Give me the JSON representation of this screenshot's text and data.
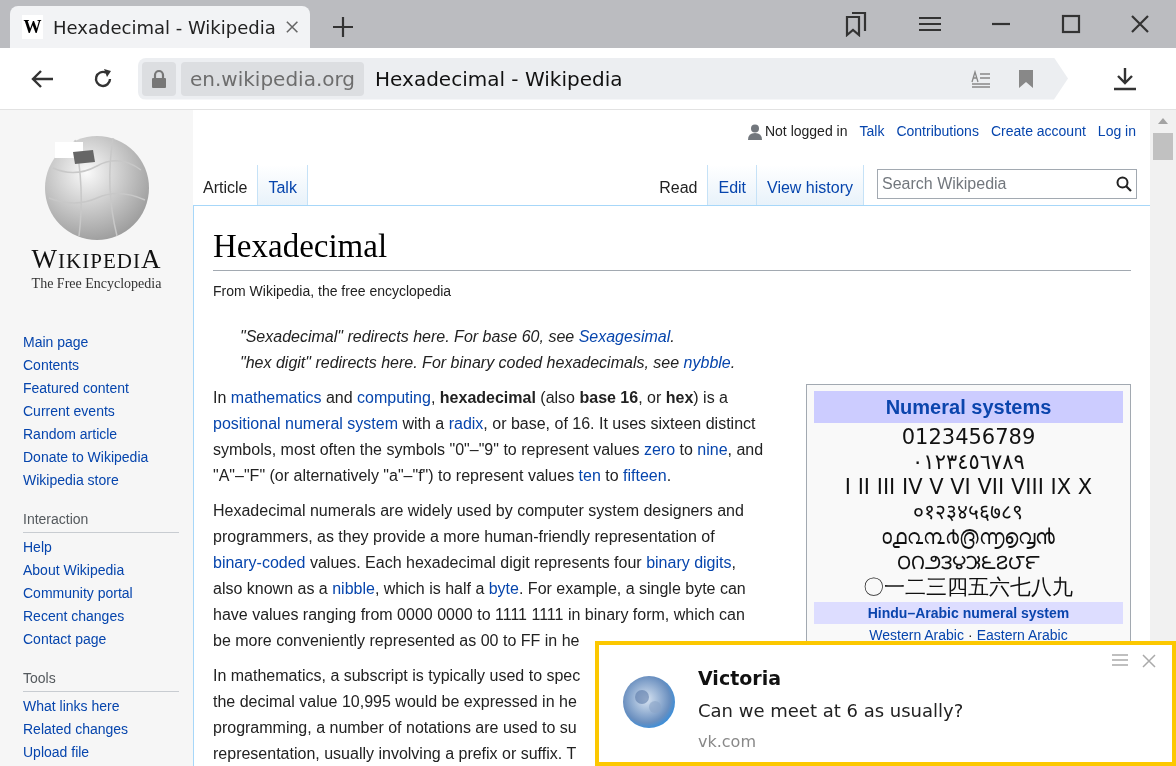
{
  "browser": {
    "tab": {
      "favicon": "W",
      "title": "Hexadecimal - Wikipedia"
    },
    "address": {
      "domain": "en.wikipedia.org",
      "page_title": "Hexadecimal - Wikipedia"
    }
  },
  "sidebar": {
    "logo": {
      "wordmark": "WIKIPEDIA",
      "tagline": "The Free Encyclopedia"
    },
    "navigation": [
      "Main page",
      "Contents",
      "Featured content",
      "Current events",
      "Random article",
      "Donate to Wikipedia",
      "Wikipedia store"
    ],
    "sections": [
      {
        "heading": "Interaction",
        "items": [
          "Help",
          "About Wikipedia",
          "Community portal",
          "Recent changes",
          "Contact page"
        ]
      },
      {
        "heading": "Tools",
        "items": [
          "What links here",
          "Related changes",
          "Upload file"
        ]
      }
    ]
  },
  "personal_tools": {
    "status": "Not logged in",
    "links": [
      "Talk",
      "Contributions",
      "Create account",
      "Log in"
    ]
  },
  "page_tabs": {
    "left": [
      {
        "label": "Article",
        "selected": true
      },
      {
        "label": "Talk",
        "selected": false
      }
    ],
    "right": [
      {
        "label": "Read",
        "selected": true
      },
      {
        "label": "Edit",
        "selected": false
      },
      {
        "label": "View history",
        "selected": false
      }
    ]
  },
  "search": {
    "placeholder": "Search Wikipedia"
  },
  "article": {
    "title": "Hexadecimal",
    "subtitle": "From Wikipedia, the free encyclopedia",
    "hatnotes": [
      [
        {
          "text": "\"Sexadecimal\" redirects here. For base 60, see ",
          "kind": "plain"
        },
        {
          "text": "Sexagesimal",
          "kind": "link"
        },
        {
          "text": ".",
          "kind": "plain"
        }
      ],
      [
        {
          "text": "\"hex digit\" redirects here. For binary coded hexadecimals, see ",
          "kind": "plain"
        },
        {
          "text": "nybble",
          "kind": "link"
        },
        {
          "text": ".",
          "kind": "plain"
        }
      ]
    ],
    "paragraphs": [
      [
        [
          {
            "text": "In ",
            "kind": "plain"
          },
          {
            "text": "mathematics",
            "kind": "link"
          },
          {
            "text": " and ",
            "kind": "plain"
          },
          {
            "text": "computing",
            "kind": "link"
          },
          {
            "text": ", ",
            "kind": "plain"
          },
          {
            "text": "hexadecimal",
            "kind": "bold"
          },
          {
            "text": " (also ",
            "kind": "plain"
          },
          {
            "text": "base 16",
            "kind": "bold"
          },
          {
            "text": ", or ",
            "kind": "plain"
          },
          {
            "text": "hex",
            "kind": "bold"
          },
          {
            "text": ") is a",
            "kind": "plain"
          }
        ],
        [
          {
            "text": "positional numeral system",
            "kind": "link"
          },
          {
            "text": " with a ",
            "kind": "plain"
          },
          {
            "text": "radix",
            "kind": "link"
          },
          {
            "text": ", or base, of 16. It uses sixteen distinct",
            "kind": "plain"
          }
        ],
        [
          {
            "text": "symbols, most often the symbols \"0\"–\"9\" to represent values ",
            "kind": "plain"
          },
          {
            "text": "zero",
            "kind": "link"
          },
          {
            "text": " to ",
            "kind": "plain"
          },
          {
            "text": "nine",
            "kind": "link"
          },
          {
            "text": ", and",
            "kind": "plain"
          }
        ],
        [
          {
            "text": "\"A\"–\"F\" (or alternatively \"a\"–\"f\") to represent values ",
            "kind": "plain"
          },
          {
            "text": "ten",
            "kind": "link"
          },
          {
            "text": " to ",
            "kind": "plain"
          },
          {
            "text": "fifteen",
            "kind": "link"
          },
          {
            "text": ".",
            "kind": "plain"
          }
        ]
      ],
      [
        [
          {
            "text": "Hexadecimal numerals are widely used by computer system designers and",
            "kind": "plain"
          }
        ],
        [
          {
            "text": "programmers, as they provide a more human-friendly representation of",
            "kind": "plain"
          }
        ],
        [
          {
            "text": "binary-coded",
            "kind": "link"
          },
          {
            "text": " values. Each hexadecimal digit represents four ",
            "kind": "plain"
          },
          {
            "text": "binary digits",
            "kind": "link"
          },
          {
            "text": ",",
            "kind": "plain"
          }
        ],
        [
          {
            "text": "also known as a ",
            "kind": "plain"
          },
          {
            "text": "nibble",
            "kind": "link"
          },
          {
            "text": ", which is half a ",
            "kind": "plain"
          },
          {
            "text": "byte",
            "kind": "link"
          },
          {
            "text": ". For example, a single byte can",
            "kind": "plain"
          }
        ],
        [
          {
            "text": "have values ranging from 0000 0000 to 1111 1111 in binary form, which can",
            "kind": "plain"
          }
        ],
        [
          {
            "text": "be more conveniently represented as 00 to FF in he",
            "kind": "plain"
          }
        ]
      ],
      [
        [
          {
            "text": "In mathematics, a subscript is typically used to spec",
            "kind": "plain"
          }
        ],
        [
          {
            "text": "the decimal value 10,995 would be expressed in he",
            "kind": "plain"
          }
        ],
        [
          {
            "text": "programming, a number of notations are used to su",
            "kind": "plain"
          }
        ],
        [
          {
            "text": "representation, usually involving a prefix or suffix. T",
            "kind": "plain"
          }
        ]
      ]
    ]
  },
  "infobox": {
    "title": "Numeral systems",
    "numerals": [
      "0123456789",
      "٠١٢٣٤٥٦٧٨٩",
      "I II III IV V VI VII VIII IX X",
      "०१२३४५६७८९",
      "൦൧൨൩൪൫൬൭൮൯",
      "౦౧౨౩౪౫౬౭౮౯",
      "〇一二三四五六七八九"
    ],
    "subheading": "Hindu–Arabic numeral system",
    "links": [
      "Western Arabic",
      "Eastern Arabic"
    ],
    "separator": "·"
  },
  "notification": {
    "sender": "Victoria",
    "message": "Can we meet at 6 as usually?",
    "source": "vk.com"
  }
}
